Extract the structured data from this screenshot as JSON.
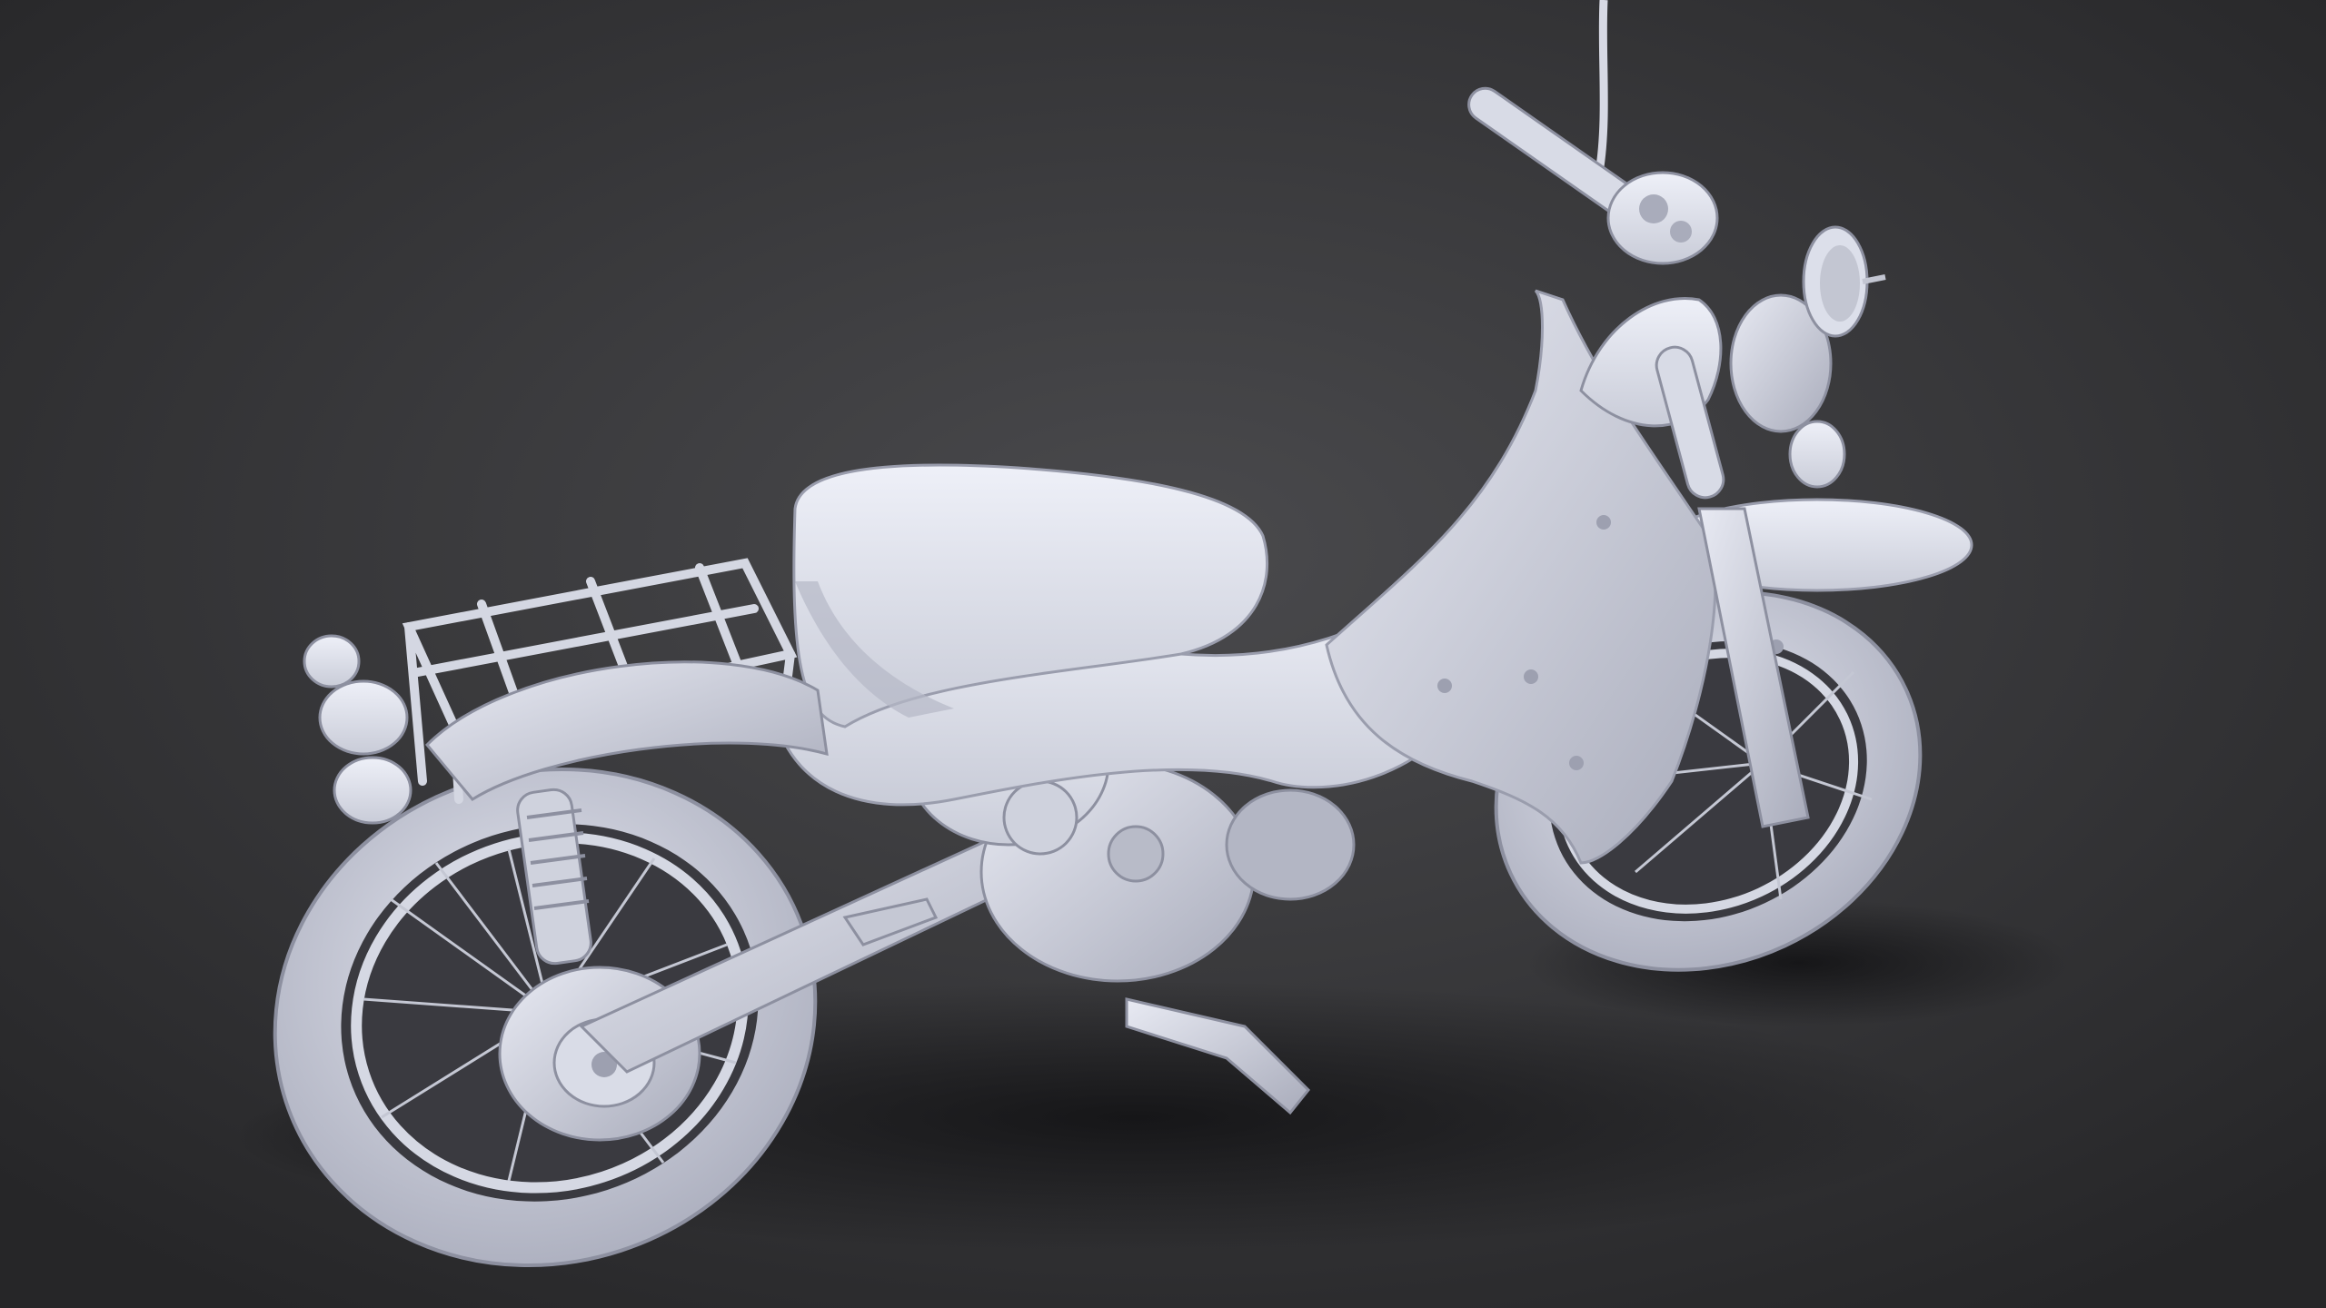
{
  "scene": {
    "subject": "moped-clay-render",
    "colors": {
      "background_center": "#4a4a4d",
      "background_edge": "#262628",
      "clay_light": "#eef0f8",
      "clay_mid": "#c9ccd8",
      "clay_dark": "#8d90a0",
      "shadow": "#17171a"
    }
  }
}
